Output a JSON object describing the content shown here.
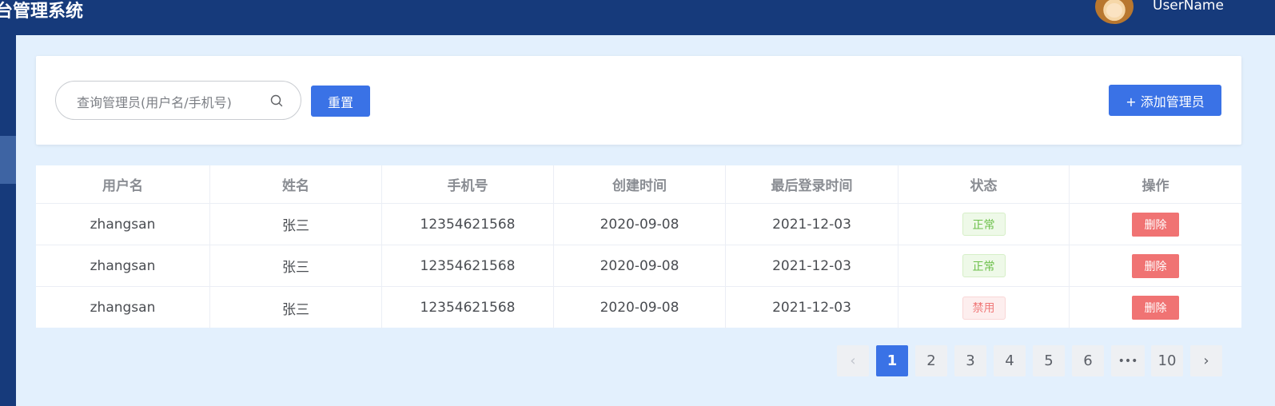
{
  "header": {
    "app_title": "台管理系统",
    "username": "UserName"
  },
  "toolbar": {
    "search_placeholder": "查询管理员(用户名/手机号)",
    "reset_label": "重置",
    "add_label": "+ 添加管理员"
  },
  "table": {
    "columns": [
      "用户名",
      "姓名",
      "手机号",
      "创建时间",
      "最后登录时间",
      "状态",
      "操作"
    ],
    "rows": [
      {
        "username": "zhangsan",
        "name": "张三",
        "phone": "12354621568",
        "created": "2020-09-08",
        "last_login": "2021-12-03",
        "status": "正常",
        "status_type": "ok",
        "action": "删除"
      },
      {
        "username": "zhangsan",
        "name": "张三",
        "phone": "12354621568",
        "created": "2020-09-08",
        "last_login": "2021-12-03",
        "status": "正常",
        "status_type": "ok",
        "action": "删除"
      },
      {
        "username": "zhangsan",
        "name": "张三",
        "phone": "12354621568",
        "created": "2020-09-08",
        "last_login": "2021-12-03",
        "status": "禁用",
        "status_type": "ban",
        "action": "删除"
      }
    ]
  },
  "pagination": {
    "prev": "‹",
    "pages": [
      "1",
      "2",
      "3",
      "4",
      "5",
      "6",
      "•••",
      "10"
    ],
    "active": "1",
    "next": "›"
  },
  "colors": {
    "header_bg": "#163a7b",
    "primary": "#3a72e6",
    "danger": "#f07373",
    "success": "#6cc04a",
    "page_bg": "#e3f0fd"
  }
}
